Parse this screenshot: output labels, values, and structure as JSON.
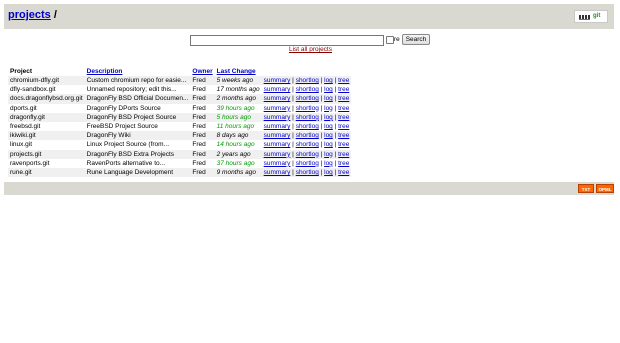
{
  "header": {
    "title": "projects",
    "separator": "/",
    "logo_text": "git"
  },
  "search": {
    "value": "",
    "re_label": "re",
    "button_label": "Search",
    "list_all_label": "List all projects"
  },
  "table": {
    "columns": {
      "project": "Project",
      "description": "Description",
      "owner": "Owner",
      "last_change": "Last Change"
    },
    "links": {
      "summary": "summary",
      "shortlog": "shortlog",
      "log": "log",
      "tree": "tree",
      "sep": " | "
    },
    "rows": [
      {
        "project": "chromium-dfly.git",
        "description": "Custom chromium repo for easie...",
        "owner": "Fred",
        "age": "5 weeks ago",
        "recent": false
      },
      {
        "project": "dfly-sandbox.git",
        "description": "Unnamed repository; edit this...",
        "owner": "Fred",
        "age": "17 months ago",
        "recent": false
      },
      {
        "project": "docs.dragonflybsd.org.git",
        "description": "DragonFly BSD Official Documen...",
        "owner": "Fred",
        "age": "2 months ago",
        "recent": false
      },
      {
        "project": "dports.git",
        "description": "DragonFly DPorts Source",
        "owner": "Fred",
        "age": "39 hours ago",
        "recent": true
      },
      {
        "project": "dragonfly.git",
        "description": "DragonFly BSD Project Source",
        "owner": "Fred",
        "age": "5 hours ago",
        "recent": true
      },
      {
        "project": "freebsd.git",
        "description": "FreeBSD Project Source",
        "owner": "Fred",
        "age": "11 hours ago",
        "recent": true
      },
      {
        "project": "ikiwiki.git",
        "description": "DragonFly Wiki",
        "owner": "Fred",
        "age": "8 days ago",
        "recent": false
      },
      {
        "project": "linux.git",
        "description": "Linux Project Source (from...",
        "owner": "Fred",
        "age": "14 hours ago",
        "recent": true
      },
      {
        "project": "projects.git",
        "description": "DragonFly BSD Extra Projects",
        "owner": "Fred",
        "age": "2 years ago",
        "recent": false
      },
      {
        "project": "ravenports.git",
        "description": "RavenPorts alternative to...",
        "owner": "Fred",
        "age": "37 hours ago",
        "recent": true
      },
      {
        "project": "rune.git",
        "description": "Rune Language Development",
        "owner": "Fred",
        "age": "9 months ago",
        "recent": false
      }
    ]
  },
  "footer": {
    "txt_label": "TXT",
    "opml_label": "OPML"
  },
  "colors": {
    "header_bg": "#d9d8d1",
    "recent_age": "#009900",
    "link": "#0000cc",
    "feed": "#ff6600"
  }
}
